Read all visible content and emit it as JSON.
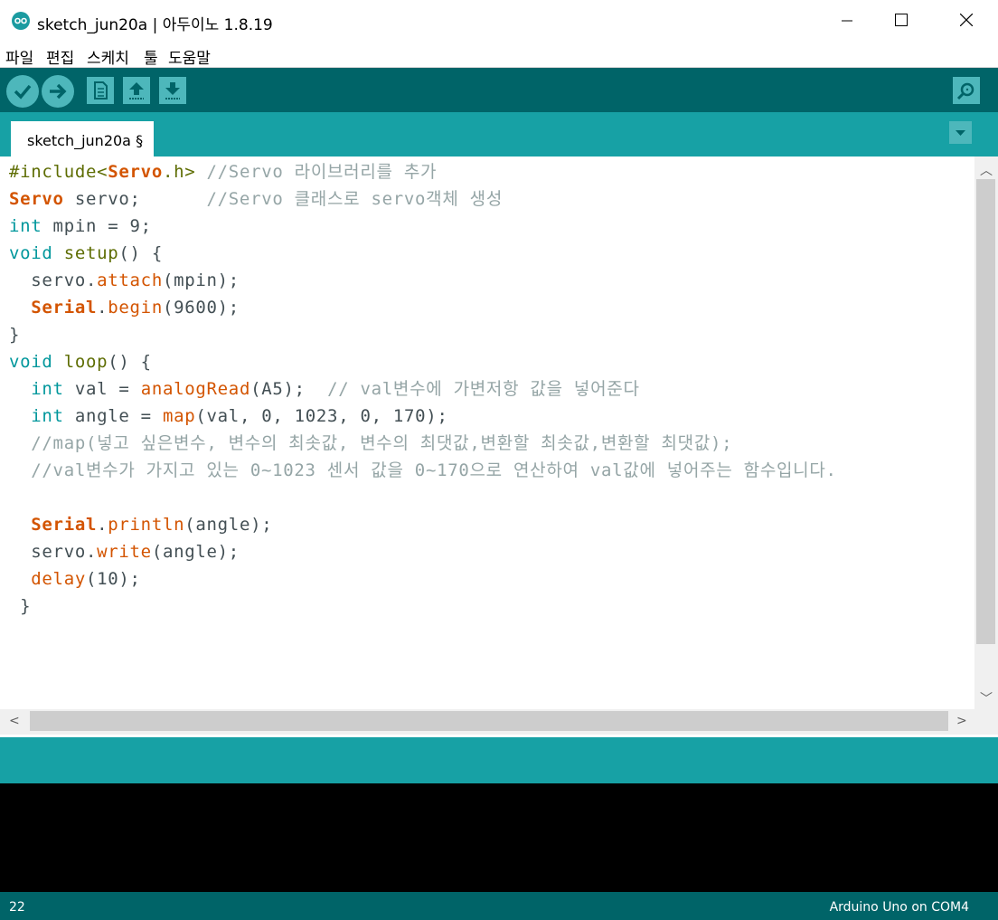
{
  "window": {
    "title": "sketch_jun20a | 아두이노 1.8.19",
    "minimize_icon": "minimize-icon",
    "maximize_icon": "maximize-icon",
    "close_icon": "close-icon"
  },
  "menu": {
    "items": [
      "파일",
      "편집",
      "스케치",
      "툴",
      "도움말"
    ]
  },
  "toolbar": {
    "buttons": [
      "verify-icon",
      "upload-icon",
      "new-icon",
      "open-icon",
      "save-icon",
      "serial-monitor-icon"
    ]
  },
  "tabs": [
    {
      "label": "sketch_jun20a §"
    }
  ],
  "code": {
    "lines": [
      "#include<Servo.h> //Servo 라이브러리를 추가",
      "Servo servo;      //Servo 클래스로 servo객체 생성",
      "int mpin = 9;",
      "void setup() {",
      "  servo.attach(mpin);",
      "  Serial.begin(9600);",
      "}",
      "void loop() {",
      "  int val = analogRead(A5);  // val변수에 가변저항 값을 넣어준다",
      "  int angle = map(val, 0, 1023, 0, 170);",
      "  //map(넣고 싶은변수, 변수의 최솟값, 변수의 최댓값,변환할 최솟값,변환할 최댓값);",
      "  //val변수가 가지고 있는 0~1023 센서 값을 0~170으로 연산하여 val값에 넣어주는 함수입니다.",
      "",
      "  Serial.println(angle);",
      "  servo.write(angle);",
      "  delay(10);",
      " }"
    ]
  },
  "status": {
    "line": "22",
    "board": "Arduino Uno on COM4"
  },
  "colors": {
    "toolbar": "#006468",
    "tabbar": "#17a1a5",
    "button": "#4db7bb",
    "keyword": "#00979c",
    "function": "#d35400",
    "comment": "#95a5a6"
  }
}
